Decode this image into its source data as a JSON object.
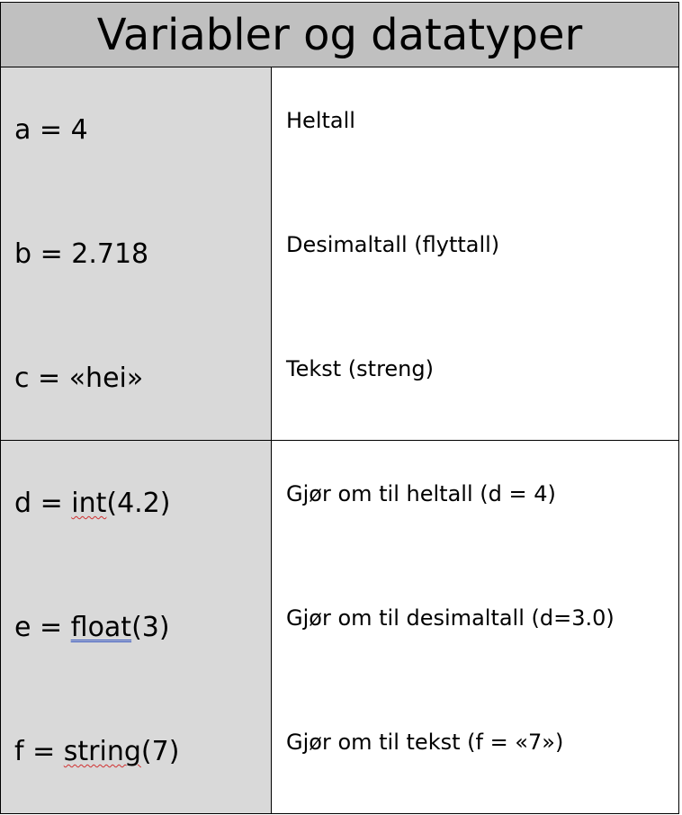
{
  "title": "Variabler og datatyper",
  "rows": [
    {
      "pre": "a = 4",
      "fn": "",
      "post": "",
      "desc": "Heltall"
    },
    {
      "pre": "b = 2.718",
      "fn": "",
      "post": "",
      "desc": "Desimaltall (flyttall)"
    },
    {
      "pre": "c = «hei»",
      "fn": "",
      "post": "",
      "desc": "Tekst (streng)"
    },
    {
      "pre": "d = ",
      "fn": "int",
      "post": "(4.2)",
      "desc": "Gjør om til heltall (d = 4)"
    },
    {
      "pre": "e = ",
      "fn": "float",
      "post": "(3)",
      "desc": "Gjør om til desimaltall (d=3.0)"
    },
    {
      "pre": "f = ",
      "fn": "string",
      "post": "(7)",
      "desc": "Gjør om til tekst (f = «7»)"
    }
  ]
}
